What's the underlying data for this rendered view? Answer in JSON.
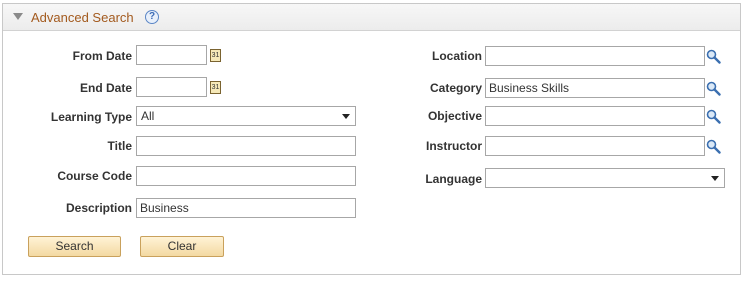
{
  "panel": {
    "title": "Advanced Search",
    "help": "?"
  },
  "left": {
    "from_date": {
      "label": "From Date",
      "value": ""
    },
    "end_date": {
      "label": "End Date",
      "value": ""
    },
    "learning_type": {
      "label": "Learning Type",
      "value": "All"
    },
    "title": {
      "label": "Title",
      "value": ""
    },
    "course_code": {
      "label": "Course Code",
      "value": ""
    },
    "description": {
      "label": "Description",
      "value": "Business"
    }
  },
  "right": {
    "location": {
      "label": "Location",
      "value": ""
    },
    "category": {
      "label": "Category",
      "value": "Business Skills"
    },
    "objective": {
      "label": "Objective",
      "value": ""
    },
    "instructor": {
      "label": "Instructor",
      "value": ""
    },
    "language": {
      "label": "Language",
      "value": ""
    }
  },
  "icons": {
    "calendar": "31"
  },
  "buttons": {
    "search": "Search",
    "clear": "Clear"
  }
}
